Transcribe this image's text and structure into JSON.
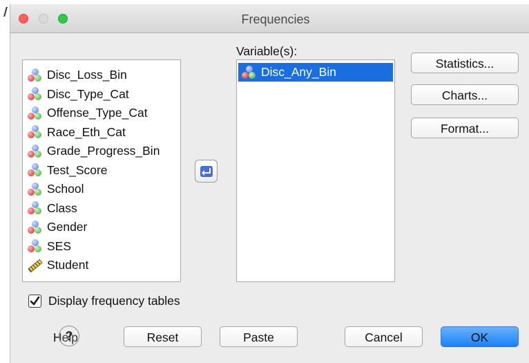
{
  "window": {
    "title": "Frequencies"
  },
  "source_list": {
    "items": [
      {
        "label": "Disc_Loss_Bin",
        "icon": "nominal-icon"
      },
      {
        "label": "Disc_Type_Cat",
        "icon": "nominal-icon"
      },
      {
        "label": "Offense_Type_Cat",
        "icon": "nominal-icon"
      },
      {
        "label": "Race_Eth_Cat",
        "icon": "nominal-icon"
      },
      {
        "label": "Grade_Progress_Bin",
        "icon": "nominal-icon"
      },
      {
        "label": "Test_Score",
        "icon": "nominal-icon"
      },
      {
        "label": "School",
        "icon": "nominal-icon"
      },
      {
        "label": "Class",
        "icon": "nominal-icon"
      },
      {
        "label": "Gender",
        "icon": "nominal-icon"
      },
      {
        "label": "SES",
        "icon": "nominal-icon"
      },
      {
        "label": "Student",
        "icon": "scale-ruler-icon"
      }
    ]
  },
  "variables": {
    "label": "Variable(s):",
    "items": [
      {
        "label": "Disc_Any_Bin",
        "icon": "nominal-icon",
        "selected": true
      }
    ]
  },
  "side_buttons": {
    "statistics": "Statistics...",
    "charts": "Charts...",
    "format": "Format..."
  },
  "display_frequency_tables": {
    "label": "Display frequency tables",
    "checked": true
  },
  "footer": {
    "help": "Help",
    "reset": "Reset",
    "paste": "Paste",
    "cancel": "Cancel",
    "ok": "OK"
  },
  "colors": {
    "selection": "#1b6ee0",
    "ok_button": "#1a82fb"
  }
}
